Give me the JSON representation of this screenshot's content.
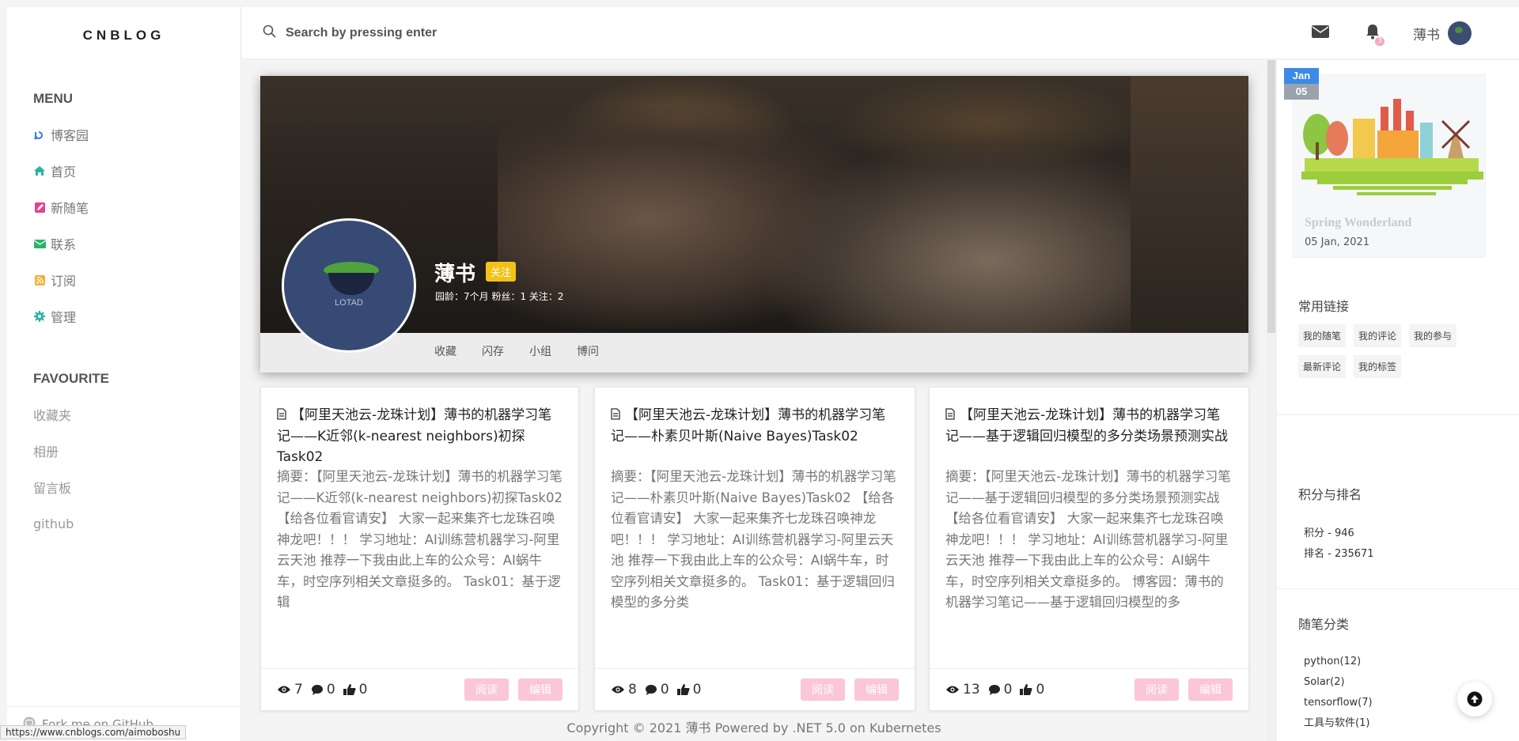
{
  "brand": {
    "logo": "CNBLOG"
  },
  "sidebar": {
    "menu_title": "MENU",
    "items": [
      {
        "label": "博客园",
        "icon": "blog-icon",
        "color": "#2c7be5"
      },
      {
        "label": "首页",
        "icon": "home-icon",
        "color": "#2bb3a3"
      },
      {
        "label": "新随笔",
        "icon": "edit-icon",
        "color": "#e5418f"
      },
      {
        "label": "联系",
        "icon": "envelope-icon",
        "color": "#2bb36b"
      },
      {
        "label": "订阅",
        "icon": "rss-icon",
        "color": "#f2b23a"
      },
      {
        "label": "管理",
        "icon": "gear-icon",
        "color": "#2bb3a3"
      }
    ],
    "fav_title": "FAVOURITE",
    "fav_items": [
      "收藏夹",
      "相册",
      "留言板",
      "github"
    ],
    "fork": "Fork me on GitHub"
  },
  "header": {
    "search_placeholder": "Search by pressing enter",
    "username": "薄书",
    "bell_badge": "3"
  },
  "profile": {
    "name": "薄书",
    "follow": "关注",
    "stats": "园龄：7个月  粉丝：1  关注：2",
    "avatar_label": "LOTAD",
    "tabs": [
      "收藏",
      "闪存",
      "小组",
      "博问"
    ]
  },
  "posts": [
    {
      "title": "【阿里天池云-龙珠计划】薄书的机器学习笔记——K近邻(k-nearest neighbors)初探Task02",
      "summary": "摘要：【阿里天池云-龙珠计划】薄书的机器学习笔记——K近邻(k-nearest neighbors)初探Task02 【给各位看官请安】 大家一起来集齐七龙珠召唤神龙吧！！！ 学习地址：AI训练营机器学习-阿里云天池 推荐一下我由此上车的公众号：AI蜗牛车，时空序列相关文章挺多的。 Task01：基于逻辑",
      "views": "7",
      "comments": "0",
      "likes": "0",
      "read": "阅读",
      "edit": "编辑"
    },
    {
      "title": "【阿里天池云-龙珠计划】薄书的机器学习笔记——朴素贝叶斯(Naive Bayes)Task02",
      "summary": "摘要：【阿里天池云-龙珠计划】薄书的机器学习笔记——朴素贝叶斯(Naive Bayes)Task02 【给各位看官请安】 大家一起来集齐七龙珠召唤神龙吧！！！ 学习地址：AI训练营机器学习-阿里云天池 推荐一下我由此上车的公众号：AI蜗牛车，时空序列相关文章挺多的。 Task01：基于逻辑回归模型的多分类",
      "views": "8",
      "comments": "0",
      "likes": "0",
      "read": "阅读",
      "edit": "编辑"
    },
    {
      "title": "【阿里天池云-龙珠计划】薄书的机器学习笔记——基于逻辑回归模型的多分类场景预测实战",
      "summary": "摘要：【阿里天池云-龙珠计划】薄书的机器学习笔记——基于逻辑回归模型的多分类场景预测实战 【给各位看官请安】 大家一起来集齐七龙珠召唤神龙吧！！！ 学习地址：AI训练营机器学习-阿里云天池 推荐一下我由此上车的公众号：AI蜗牛车，时空序列相关文章挺多的。 博客园：薄书的机器学习笔记——基于逻辑回归模型的多",
      "views": "13",
      "comments": "0",
      "likes": "0",
      "read": "阅读",
      "edit": "编辑"
    }
  ],
  "footer": {
    "copyright": "Copyright © 2021 薄书    Powered by .NET 5.0 on Kubernetes"
  },
  "right": {
    "calendar": {
      "month": "Jan",
      "day": "05",
      "title": "Spring Wonderland",
      "date": "05 Jan, 2021"
    },
    "links_title": "常用链接",
    "links": [
      "我的随笔",
      "我的评论",
      "我的参与",
      "最新评论",
      "我的标签"
    ],
    "rank_title": "积分与排名",
    "rank": [
      "积分 - 946",
      "排名 - 235671"
    ],
    "cat_title": "随笔分类",
    "categories": [
      "python(12)",
      "Solar(2)",
      "tensorflow(7)",
      "工具与软件(1)"
    ]
  },
  "status_url": "https://www.cnblogs.com/aimoboshu",
  "colors": {
    "accent_pink": "#fbc6d6",
    "follow_yellow": "#f2c21a",
    "calendar_blue": "#3b8ae6"
  }
}
